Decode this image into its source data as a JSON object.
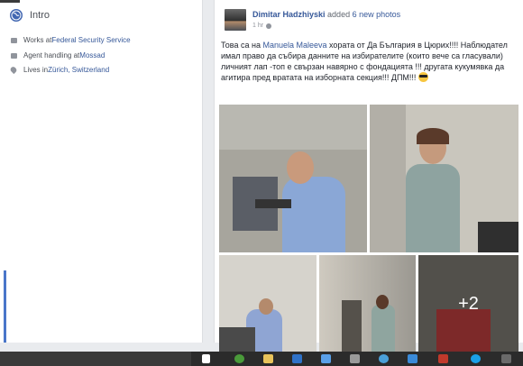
{
  "intro": {
    "title": "Intro",
    "items": [
      {
        "prefix": "Works at ",
        "link": "Federal Security Service",
        "icon": "briefcase-icon"
      },
      {
        "prefix": "Agent handling at ",
        "link": "Mossad",
        "icon": "briefcase-icon"
      },
      {
        "prefix": "Lives in ",
        "link": "Zürich, Switzerland",
        "icon": "home-pin-icon"
      }
    ]
  },
  "post": {
    "author": "Dimitar Hadzhiyski",
    "action_prefix": "added ",
    "action_link": "6 new photos",
    "time": "1 hr",
    "text_1": "Това са на ",
    "text_link": "Manuela Maleeva",
    "text_2": " хората от Да България в Цюрих!!!! Наблюдател имал право да събира данните на избирателите (които вече са гласували) личният лап -топ е свързан навярно с фондацията !!! другата кукумявка да агитира пред вратата на изборната секция!!! ДПМ!!!",
    "more_photos": "+2"
  },
  "taskbar": {
    "icons": [
      "windows-icon",
      "task-view-icon",
      "chrome-icon",
      "folder-icon",
      "mail-icon",
      "dropbox-icon",
      "store-icon",
      "explorer-icon",
      "app-icon",
      "skype-icon"
    ]
  }
}
